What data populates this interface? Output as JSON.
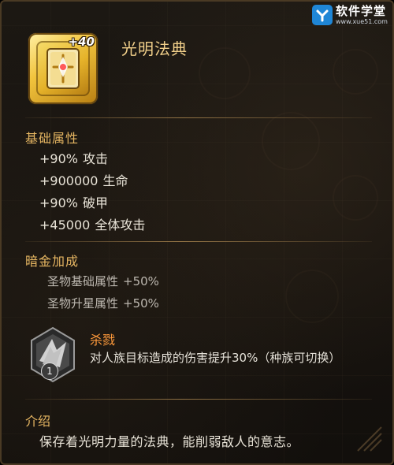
{
  "watermark": {
    "title": "软件学堂",
    "subtitle": "www.xue51.com"
  },
  "item": {
    "icon": "holy-book-icon",
    "level_badge": "+40",
    "name": "光明法典"
  },
  "base_stats": {
    "title": "基础属性",
    "rows": [
      {
        "value": "+90%",
        "label": "攻击"
      },
      {
        "value": "+900000",
        "label": "生命"
      },
      {
        "value": "+90%",
        "label": "破甲"
      },
      {
        "value": "+45000",
        "label": "全体攻击"
      }
    ]
  },
  "dark_gold": {
    "title": "暗金加成",
    "rows": [
      {
        "label": "圣物基础属性",
        "value": "+50%"
      },
      {
        "label": "圣物升星属性",
        "value": "+50%"
      }
    ]
  },
  "skill": {
    "icon": "crystal-shard-icon",
    "level": "1",
    "name": "杀戮",
    "description": "对人族目标造成的伤害提升30%（种族可切换）"
  },
  "intro": {
    "title": "介绍",
    "text": "保存着光明力量的法典，能削弱敌人的意志。"
  },
  "colors": {
    "accent_gold": "#e6b662",
    "title_gold": "#f2d08a",
    "skill_orange": "#ff9a3b",
    "body_text": "#e9e4d8",
    "panel_bg": "#17130f"
  }
}
